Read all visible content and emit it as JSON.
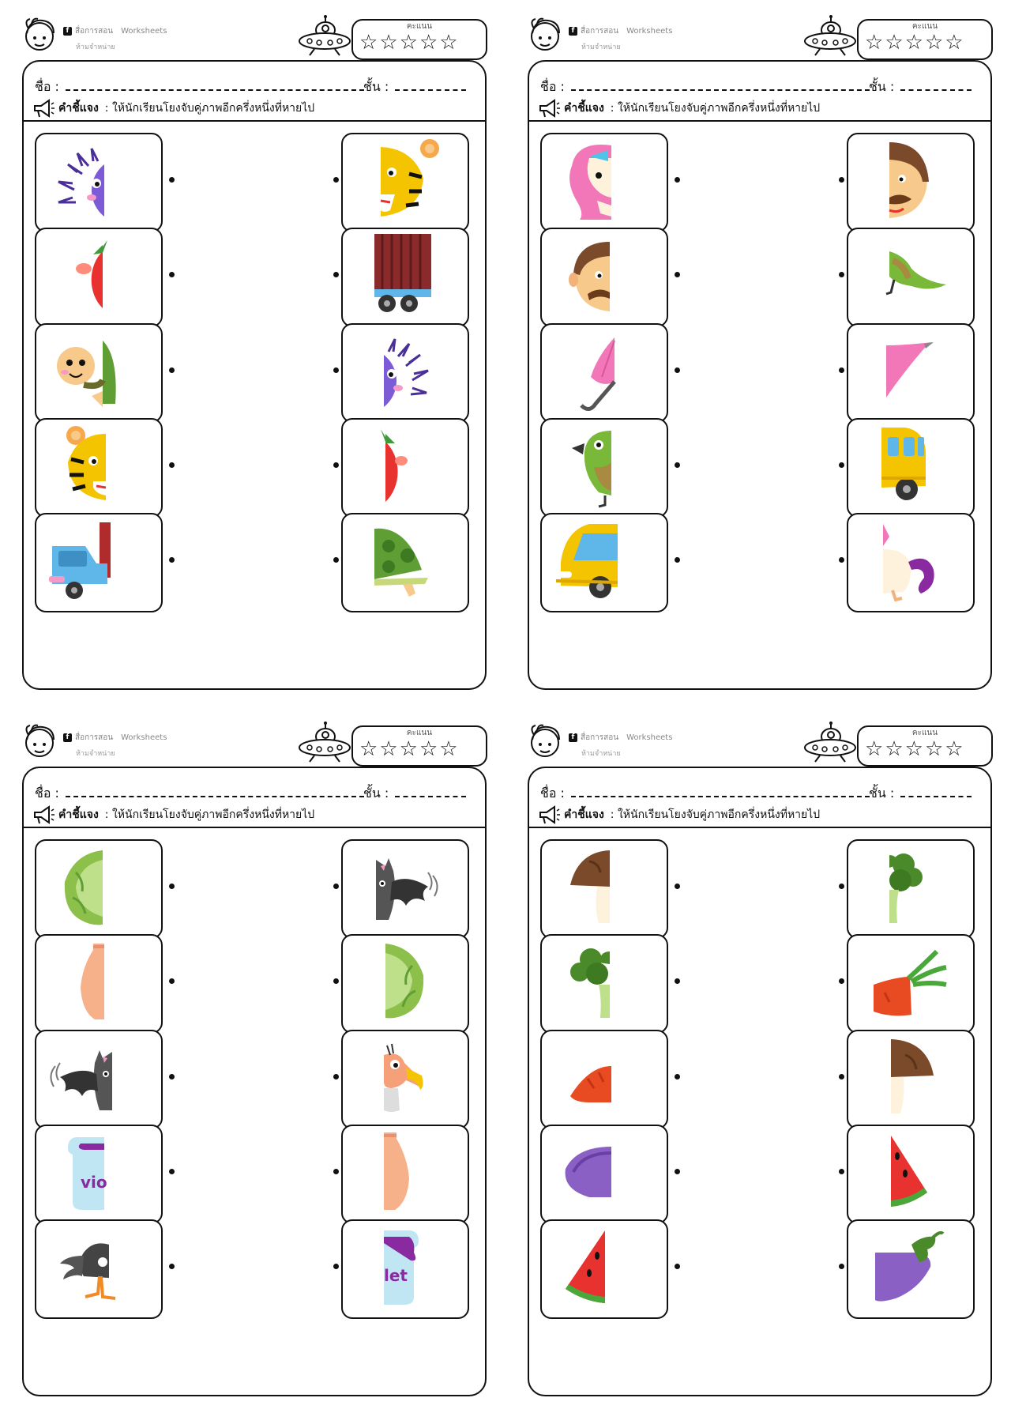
{
  "worksheet": {
    "brand_name": "สื่อการสอน",
    "brand_suffix": "Worksheets",
    "copyright": "ห้ามจำหน่าย",
    "score_label": "คะแนน",
    "name_label": "ชื่อ :",
    "class_label": "ชั้น :",
    "instruction_label": "คำชี้แจง",
    "instruction_text": ": ให้นักเรียนโยงจับคู่ภาพอีกครึ่งหนึ่งที่หายไป"
  },
  "colors": {
    "frame": "#111111",
    "purple": "#7e5bd6",
    "red": "#e8322f",
    "green": "#6aa83a",
    "yellow": "#f5c400",
    "orange": "#f08a24",
    "pink": "#f277b8",
    "brown": "#7a4a2a",
    "blue": "#5fb6e8"
  },
  "sheets": [
    {
      "left": [
        "hedgehog-left-half-icon",
        "tomato-left-half-icon",
        "turtle-left-half-icon",
        "tiger-left-half-icon",
        "truck-left-half-icon"
      ],
      "right": [
        "tiger-right-half-icon",
        "truck-right-half-icon",
        "hedgehog-right-half-icon",
        "tomato-right-half-icon",
        "turtle-right-half-icon"
      ]
    },
    {
      "left": [
        "unicorn-left-half-icon",
        "man-left-half-icon",
        "umbrella-left-half-icon",
        "parrot-left-half-icon",
        "bus-left-half-icon"
      ],
      "right": [
        "man-right-half-icon",
        "parrot-right-half-icon",
        "umbrella-right-half-icon",
        "bus-right-half-icon",
        "unicorn-right-half-icon"
      ]
    },
    {
      "left": [
        "cabbage-left-half-icon",
        "vase-left-half-icon",
        "bat-left-half-icon",
        "jar-left-half-icon",
        "vulture-left-half-icon"
      ],
      "right": [
        "bat-right-half-icon",
        "cabbage-right-half-icon",
        "vulture-right-half-icon",
        "vase-right-half-icon",
        "jar-right-half-icon"
      ]
    },
    {
      "left": [
        "mushroom-left-half-icon",
        "broccoli-left-half-icon",
        "carrot-left-half-icon",
        "eggplant-left-half-icon",
        "watermelon-left-half-icon"
      ],
      "right": [
        "broccoli-right-half-icon",
        "carrot-right-half-icon",
        "mushroom-right-half-icon",
        "watermelon-right-half-icon",
        "eggplant-right-half-icon"
      ]
    }
  ]
}
